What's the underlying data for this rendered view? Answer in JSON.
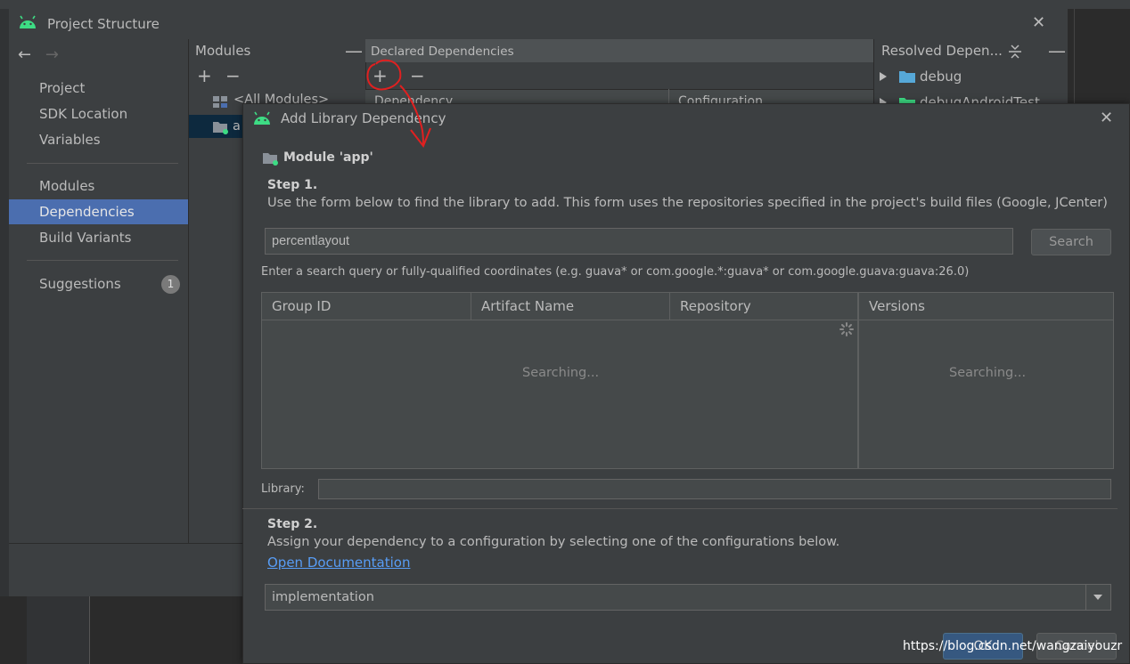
{
  "project_structure": {
    "title": "Project Structure",
    "close": "✕",
    "nav": {
      "back": "←",
      "forward": "→",
      "items": [
        {
          "label": "Project"
        },
        {
          "label": "SDK Location"
        },
        {
          "label": "Variables"
        },
        {
          "label": "Modules"
        },
        {
          "label": "Dependencies",
          "selected": true
        },
        {
          "label": "Build Variants"
        },
        {
          "label": "Suggestions",
          "badge": "1"
        }
      ]
    },
    "modules": {
      "header": "Modules",
      "collapse": "—",
      "add": "+",
      "remove": "−",
      "items": [
        "<All Modules>",
        "app"
      ]
    },
    "declared": {
      "header": "Declared Dependencies",
      "add": "+",
      "remove": "−",
      "columns": [
        "Dependency",
        "Configuration"
      ]
    },
    "resolved": {
      "header": "Resolved Depen...",
      "collapse": "—",
      "items": [
        "debug",
        "debugAndroidTest"
      ]
    }
  },
  "dialog": {
    "title": "Add Library Dependency",
    "close": "✕",
    "module_label": "Module 'app'",
    "step1": {
      "heading": "Step 1.",
      "description": "Use the form below to find the library to add. This form uses the repositories specified in the project's build files (Google, JCenter)",
      "search_value": "percentlayout",
      "search_button": "Search",
      "hint": "Enter a search query or fully-qualified coordinates (e.g. guava* or com.google.*:guava* or com.google.guava:guava:26.0)"
    },
    "results_table": {
      "columns": [
        "Group ID",
        "Artifact Name",
        "Repository"
      ],
      "status": "Searching..."
    },
    "versions_table": {
      "columns": [
        "Versions"
      ],
      "status": "Searching..."
    },
    "library_label": "Library:",
    "library_value": "",
    "step2": {
      "heading": "Step 2.",
      "description": "Assign your dependency to a configuration by selecting one of the configurations below.",
      "link": "Open Documentation",
      "configuration": "implementation"
    },
    "buttons": {
      "ok": "OK",
      "cancel": "Cancel"
    }
  },
  "watermark": "https://blog.csdn.net/wangzaiyouzr",
  "annotation_color": "#e02020",
  "accent_color": "#4b6eaf"
}
